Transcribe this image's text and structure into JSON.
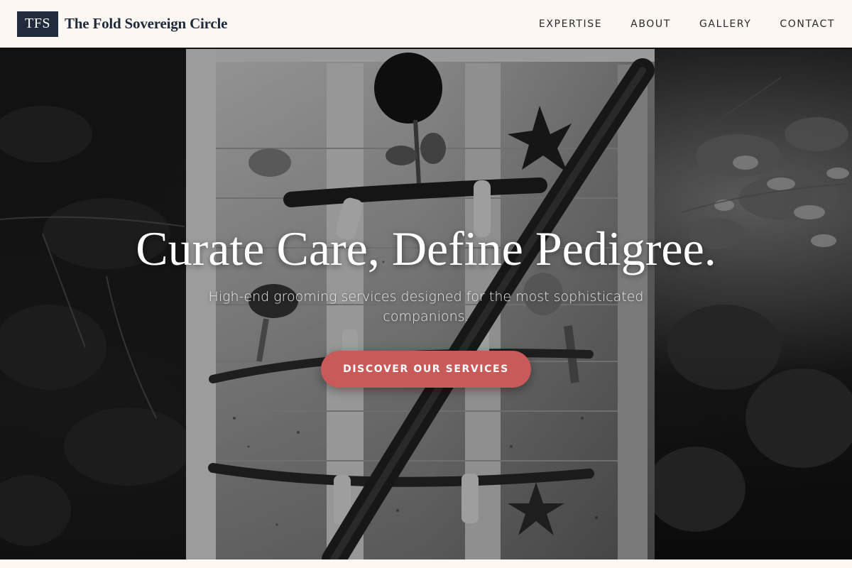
{
  "header": {
    "logo_text": "TFS",
    "brand_name": "The Fold Sovereign Circle",
    "nav": [
      "EXPERTISE",
      "ABOUT",
      "GALLERY",
      "CONTACT"
    ]
  },
  "hero": {
    "title": "Curate Care, Define Pedigree.",
    "subtitle": "High-end grooming services designed for the most sophisticated companions.",
    "cta_label": "DISCOVER OUR SERVICES",
    "image_description_icon": "bw-photo-painted-birdhouse-with-twigs"
  },
  "colors": {
    "header_bg": "#fdf7f3",
    "logo_bg": "#202b3d",
    "brand_text": "#1f2a3a",
    "cta_bg": "#c85a5a",
    "hero_text": "#ffffff"
  }
}
